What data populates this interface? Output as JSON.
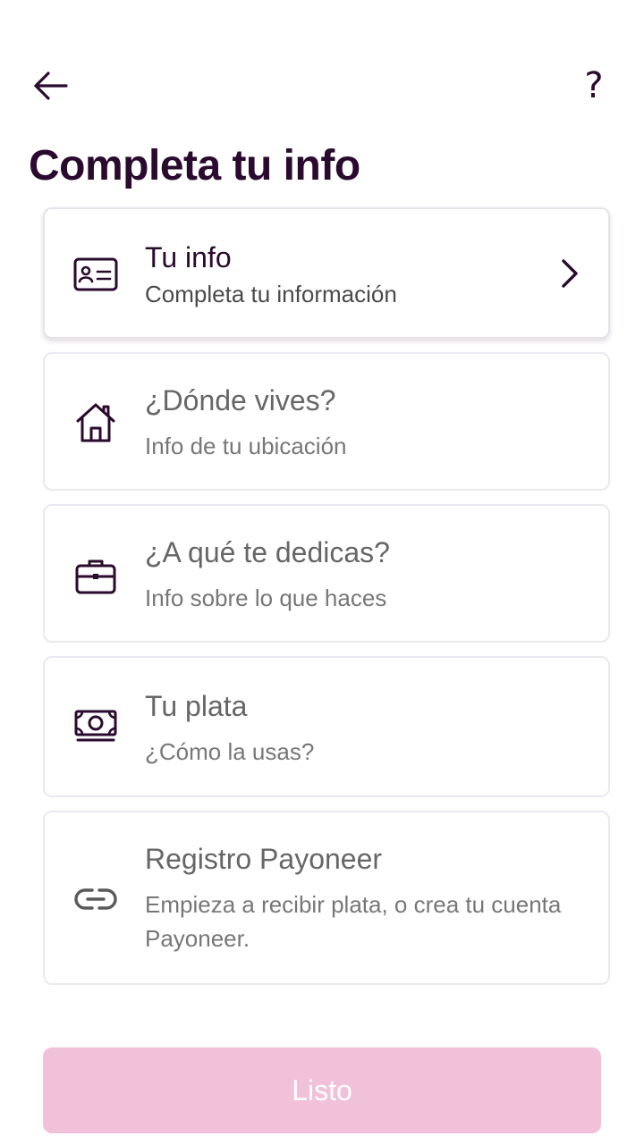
{
  "header": {
    "back_icon": "arrow-left-icon",
    "help_label": "?",
    "title": "Completa tu info"
  },
  "cards": [
    {
      "title": "Tu info",
      "subtitle": "Completa tu información",
      "icon": "id-card-icon",
      "active": true
    },
    {
      "title": "¿Dónde vives?",
      "subtitle": "Info de tu ubicación",
      "icon": "house-icon",
      "active": false
    },
    {
      "title": "¿A qué te dedicas?",
      "subtitle": "Info sobre lo que haces",
      "icon": "briefcase-icon",
      "active": false
    },
    {
      "title": "Tu plata",
      "subtitle": "¿Cómo la usas?",
      "icon": "banknote-icon",
      "active": false
    },
    {
      "title": "Registro Payoneer",
      "subtitle": "Empieza a recibir plata, o crea tu cuenta Payoneer.",
      "icon": "link-icon",
      "active": false
    }
  ],
  "footer": {
    "done_label": "Listo",
    "done_enabled": false
  },
  "colors": {
    "text_dark": "#2a0a2e",
    "button_disabled": "#f1c1da",
    "card_border": "#ebe8ef"
  }
}
